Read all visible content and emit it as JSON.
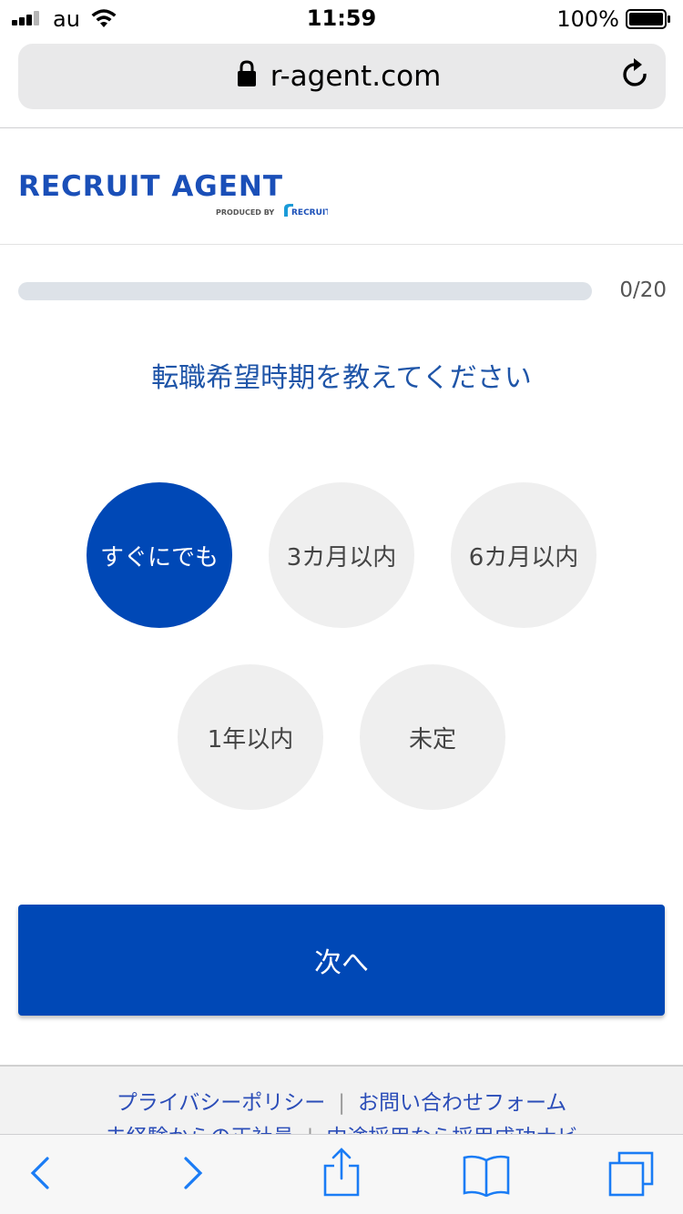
{
  "status": {
    "carrier": "au",
    "time": "11:59",
    "battery": "100%"
  },
  "browser": {
    "url": "r-agent.com"
  },
  "header": {
    "logo_text": "RECRUIT AGENT",
    "logo_sub": "PRODUCED BY",
    "logo_sub_brand": "RECRUIT"
  },
  "progress": {
    "label": "0/20",
    "fraction": 0
  },
  "question": {
    "text": "転職希望時期を教えてください"
  },
  "options": [
    {
      "label": "すぐにでも",
      "selected": true
    },
    {
      "label": "3カ月以内",
      "selected": false
    },
    {
      "label": "6カ月以内",
      "selected": false
    },
    {
      "label": "1年以内",
      "selected": false
    },
    {
      "label": "未定",
      "selected": false
    }
  ],
  "next_button": {
    "label": "次へ"
  },
  "footer": {
    "links_row1": [
      "プライバシーポリシー",
      "お問い合わせフォーム"
    ],
    "links_row2": [
      "未経験からの正社員",
      "中途採用なら採用成功ナビ"
    ]
  },
  "colors": {
    "brand_blue": "#0048b6",
    "question_blue": "#1f55a8",
    "option_bg": "#efefef",
    "footer_link": "#2b4db8",
    "ios_blue": "#1a7cf5"
  }
}
